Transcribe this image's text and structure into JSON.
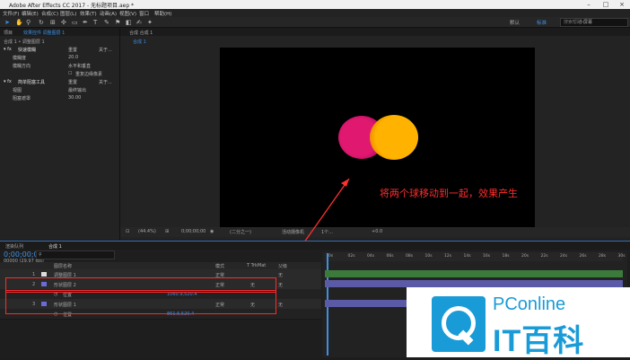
{
  "window": {
    "title": "Adobe After Effects CC 2017 - 无标题项目.aep *"
  },
  "menu": [
    "文件(F)",
    "编辑(E)",
    "合成(C)",
    "图层(L)",
    "效果(T)",
    "动画(A)",
    "视图(V)",
    "窗口",
    "帮助(H)"
  ],
  "workspace": {
    "items": [
      "默认",
      "标准",
      "小屏幕"
    ],
    "search_placeholder": "搜索帮助"
  },
  "effects_panel": {
    "tabs": [
      "项目",
      "效果控件 调整图层 1"
    ],
    "crumb": "合成 1 • 调整图层 1",
    "fx1": {
      "name": "快速模糊",
      "reset": "重置",
      "about": "关于..."
    },
    "blur_label": "模糊度",
    "blur_value": "20.0",
    "dir_label": "模糊方向",
    "dir_value": "水平和垂直",
    "repeat_label": "重复边缘像素",
    "fx2": {
      "name": "简单阻塞工具",
      "reset": "重置",
      "about": "关于..."
    },
    "view_label": "视图",
    "view_value": "最终输出",
    "choke_label": "阻塞遮罩",
    "choke_value": "30.00"
  },
  "comp_panel": {
    "tab": "合成 合成 1",
    "sub": "合成 1",
    "zoom": "(44.4%)",
    "time": "0;00;00;00",
    "res": "(二分之一)",
    "camera": "活动摄像机",
    "views": "1个...",
    "offset": "+0.0"
  },
  "annotation": "将两个球移动到一起，效果产生",
  "timeline": {
    "tabs": [
      "渲染队列",
      "合成 1"
    ],
    "timecode": "0;00;00;00",
    "fps": "00000 (29.97 fps)",
    "columns": [
      "图层名称",
      "模式",
      "T TrkMat",
      "父级"
    ],
    "layers": [
      {
        "num": "1",
        "name": "调整图层 1",
        "mode": "正常",
        "trk": "",
        "parent": "无"
      },
      {
        "num": "2",
        "name": "形状图层 2",
        "mode": "正常",
        "trk": "无",
        "parent": "无"
      },
      {
        "num": "3",
        "name": "形状图层 1",
        "mode": "正常",
        "trk": "无",
        "parent": "无"
      }
    ],
    "position_label": "位置",
    "pos2": "1060.9,520.4",
    "pos1": "861.6,520.4",
    "ruler": [
      "0s",
      "02s",
      "04s",
      "06s",
      "08s",
      "10s",
      "12s",
      "14s",
      "16s",
      "18s",
      "20s",
      "22s",
      "24s",
      "26s",
      "28s",
      "30s"
    ]
  },
  "watermark": {
    "brand": "PConline",
    "brand_cn": "IT百科"
  },
  "colors": {
    "pink": "#e0186f",
    "orange": "#ffb300",
    "blue": "#3f8fe0",
    "red": "#ff2d2d",
    "brand": "#199bd7"
  }
}
